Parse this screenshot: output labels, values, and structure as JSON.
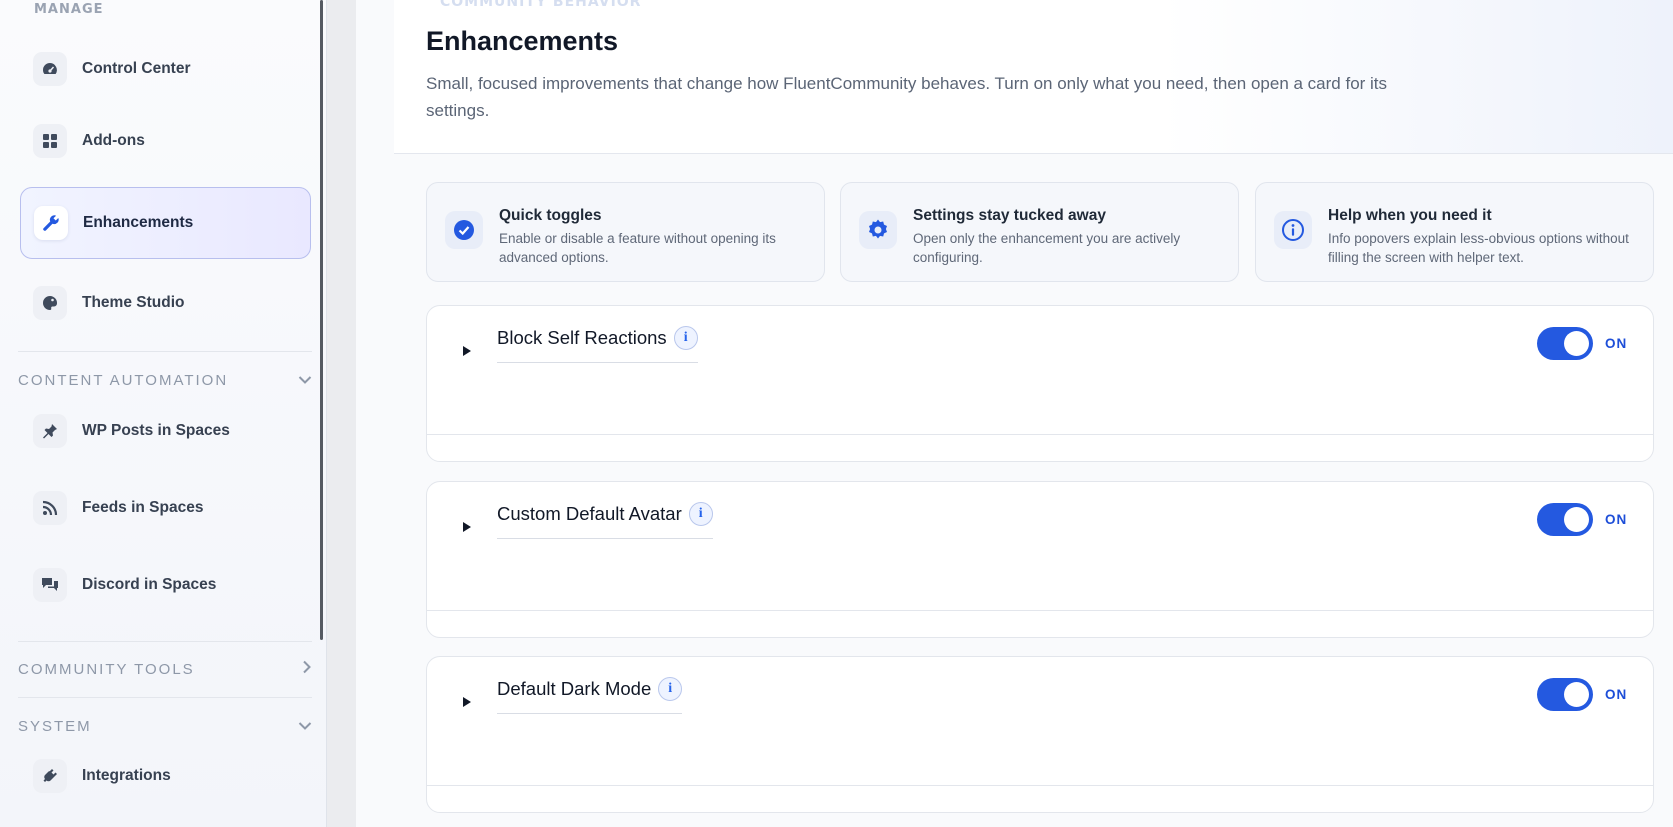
{
  "sidebar": {
    "manage_heading": "MANAGE",
    "manage_items": [
      {
        "label": "Control Center",
        "icon": "gauge-icon"
      },
      {
        "label": "Add-ons",
        "icon": "grid-icon"
      },
      {
        "label": "Enhancements",
        "icon": "wrench-icon",
        "active": true
      },
      {
        "label": "Theme Studio",
        "icon": "palette-icon"
      }
    ],
    "content_automation": {
      "heading": "CONTENT AUTOMATION",
      "expanded": true,
      "items": [
        {
          "label": "WP Posts in Spaces",
          "icon": "pin-icon"
        },
        {
          "label": "Feeds in Spaces",
          "icon": "rss-icon"
        },
        {
          "label": "Discord in Spaces",
          "icon": "chat-icon"
        }
      ]
    },
    "community_tools": {
      "heading": "COMMUNITY TOOLS",
      "expanded": false
    },
    "system": {
      "heading": "SYSTEM",
      "expanded": true,
      "items": [
        {
          "label": "Integrations",
          "icon": "plug-icon"
        }
      ]
    }
  },
  "header": {
    "eyebrow": "COMMUNITY BEHAVIOR",
    "title": "Enhancements",
    "description": "Small, focused improvements that change how FluentCommunity behaves. Turn on only what you need, then open a card for its settings."
  },
  "features": [
    {
      "title": "Quick toggles",
      "text": "Enable or disable a feature without opening its advanced options.",
      "icon": "check-circle-icon"
    },
    {
      "title": "Settings stay tucked away",
      "text": "Open only the enhancement you are actively configuring.",
      "icon": "gear-icon"
    },
    {
      "title": "Help when you need it",
      "text": "Info popovers explain less-obvious options without filling the screen with helper text.",
      "icon": "info-icon"
    }
  ],
  "enhancements": [
    {
      "title": "Block Self Reactions",
      "info": "i",
      "enabled": true,
      "status": "ON"
    },
    {
      "title": "Custom Default Avatar",
      "info": "i",
      "enabled": true,
      "status": "ON"
    },
    {
      "title": "Default Dark Mode",
      "info": "i",
      "enabled": true,
      "status": "ON"
    }
  ],
  "colors": {
    "accent": "#2459e0",
    "active_nav_border": "#b8bfee",
    "toggle_label": "#1d4ed8"
  }
}
